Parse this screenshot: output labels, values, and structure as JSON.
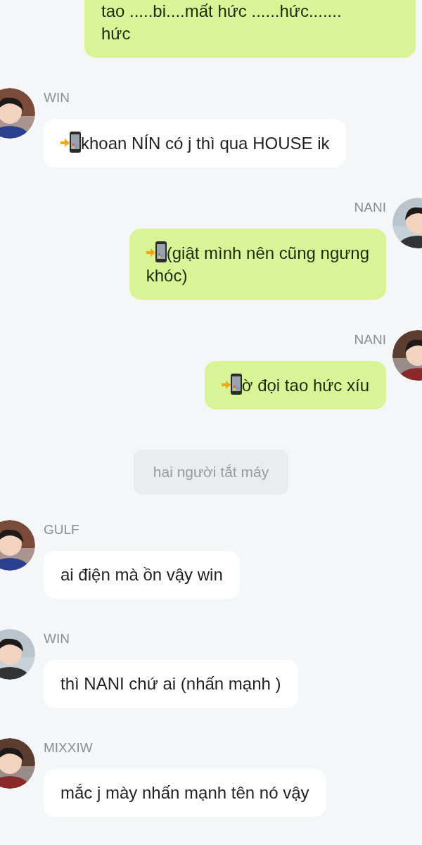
{
  "messages": [
    {
      "kind": "outgoing",
      "call": false,
      "text": "tao .....bi....mất hức ......hức.......\nhức"
    },
    {
      "kind": "incoming",
      "sender": "WIN",
      "call": true,
      "text": "khoan NÍN có j thì qua HOUSE ik"
    },
    {
      "kind": "outgoing",
      "sender": "NANI",
      "call": true,
      "text": "(giật mình nên cũng ngưng\nkhóc)"
    },
    {
      "kind": "outgoing",
      "sender": "NANI",
      "call": true,
      "text": "ờ đọi tao hức xíu"
    },
    {
      "kind": "system",
      "text": "hai người tắt máy"
    },
    {
      "kind": "incoming",
      "sender": "GULF",
      "call": false,
      "text": "ai điện mà ồn vậy win"
    },
    {
      "kind": "incoming",
      "sender": "WIN",
      "call": false,
      "text": "thì NANI chứ ai (nhấn mạnh )"
    },
    {
      "kind": "incoming",
      "sender": "MIXXIW",
      "call": false,
      "text": "mắc j mày nhấn mạnh tên nó vậy"
    }
  ]
}
